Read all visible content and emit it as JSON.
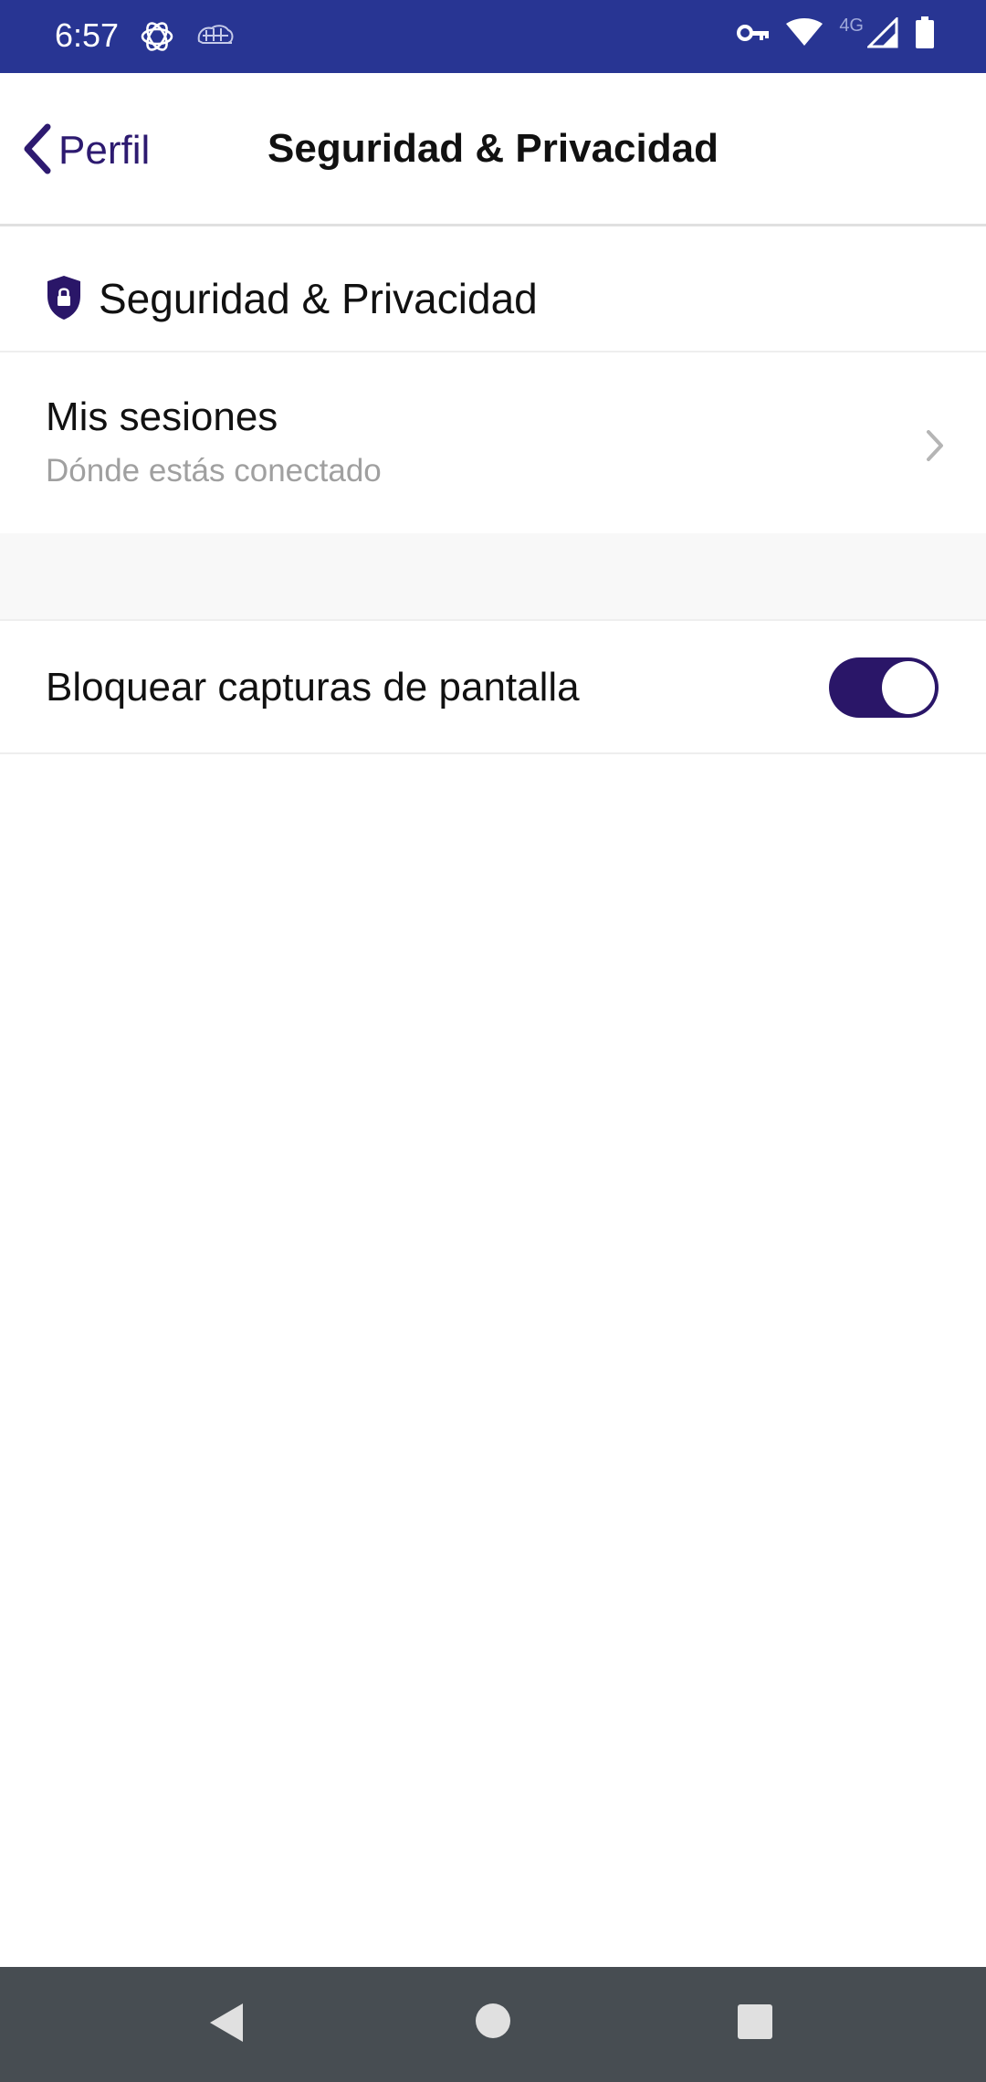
{
  "status_bar": {
    "time": "6:57",
    "left_icons": [
      "openai-icon",
      "brain-icon"
    ],
    "network": "4G",
    "right_icons": [
      "vpn-key-icon",
      "wifi-icon",
      "signal-icon",
      "battery-icon"
    ],
    "color": "#283593"
  },
  "header": {
    "back_label": "Perfil",
    "title": "Seguridad & Privacidad"
  },
  "section": {
    "title": "Seguridad & Privacidad",
    "icon": "shield-lock-icon"
  },
  "sessions": {
    "title": "Mis sesiones",
    "subtitle": "Dónde estás conectado"
  },
  "screenshot_block": {
    "label": "Bloquear capturas de pantalla",
    "enabled": true
  },
  "nav_bar": {
    "buttons": [
      "back-icon",
      "home-icon",
      "recents-icon"
    ]
  },
  "colors": {
    "accent": "#2a1668",
    "status_bar": "#283593",
    "nav_bar": "#474d52"
  }
}
